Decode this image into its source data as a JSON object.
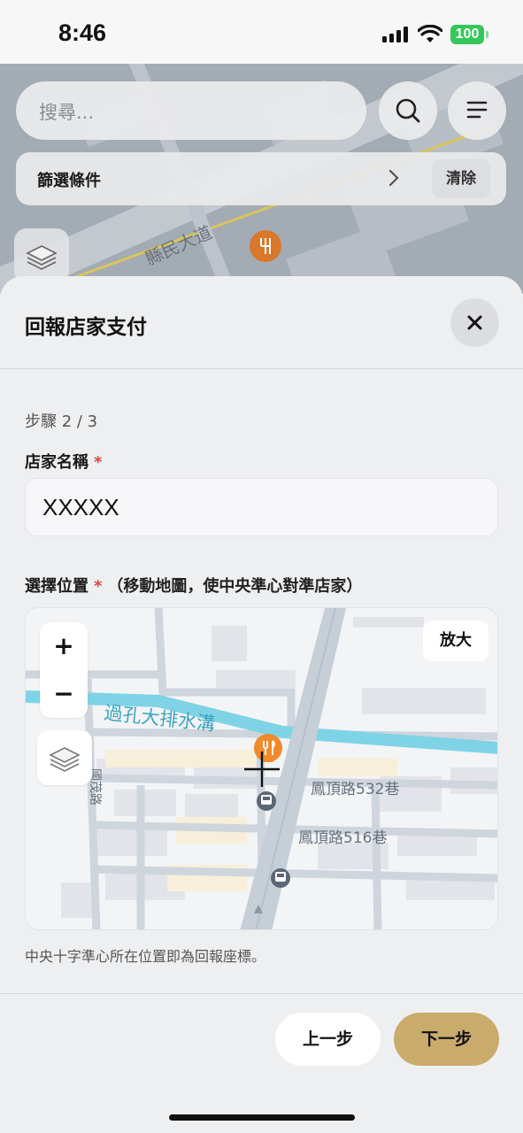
{
  "status_bar": {
    "time": "8:46",
    "battery_level": "100"
  },
  "map_header": {
    "search_placeholder": "搜尋...",
    "filter_label": "篩選條件",
    "clear_label": "清除",
    "road_label": "縣民大道"
  },
  "sheet": {
    "title": "回報店家支付",
    "step": "步驟 2 / 3",
    "store_name_label": "店家名稱",
    "required_mark": "*",
    "store_name_value": "XXXXX",
    "location_label": "選擇位置",
    "location_hint": "（移動地圖，使中央準心對準店家）",
    "map": {
      "zoom_in": "+",
      "zoom_out": "−",
      "enlarge_label": "放大",
      "labels": {
        "canal": "過孔大排水溝",
        "lane_532": "鳳頂路532巷",
        "lane_516": "鳳頂路516巷",
        "road_west": "國茂路"
      }
    },
    "map_caption": "中央十字準心所在位置即為回報座標。",
    "prev_label": "上一步",
    "next_label": "下一步"
  },
  "colors": {
    "accent": "#c9ab6c",
    "required": "#e0453a",
    "battery": "#34c759",
    "food_pin": "#f08a2a",
    "canal": "#7fd3e6"
  },
  "icons": [
    "search-icon",
    "menu-icon",
    "chevron-right-icon",
    "layers-icon",
    "close-icon",
    "food-pin-icon",
    "crosshair-icon",
    "bus-stop-icon",
    "wifi-icon",
    "signal-icon",
    "battery-icon"
  ]
}
